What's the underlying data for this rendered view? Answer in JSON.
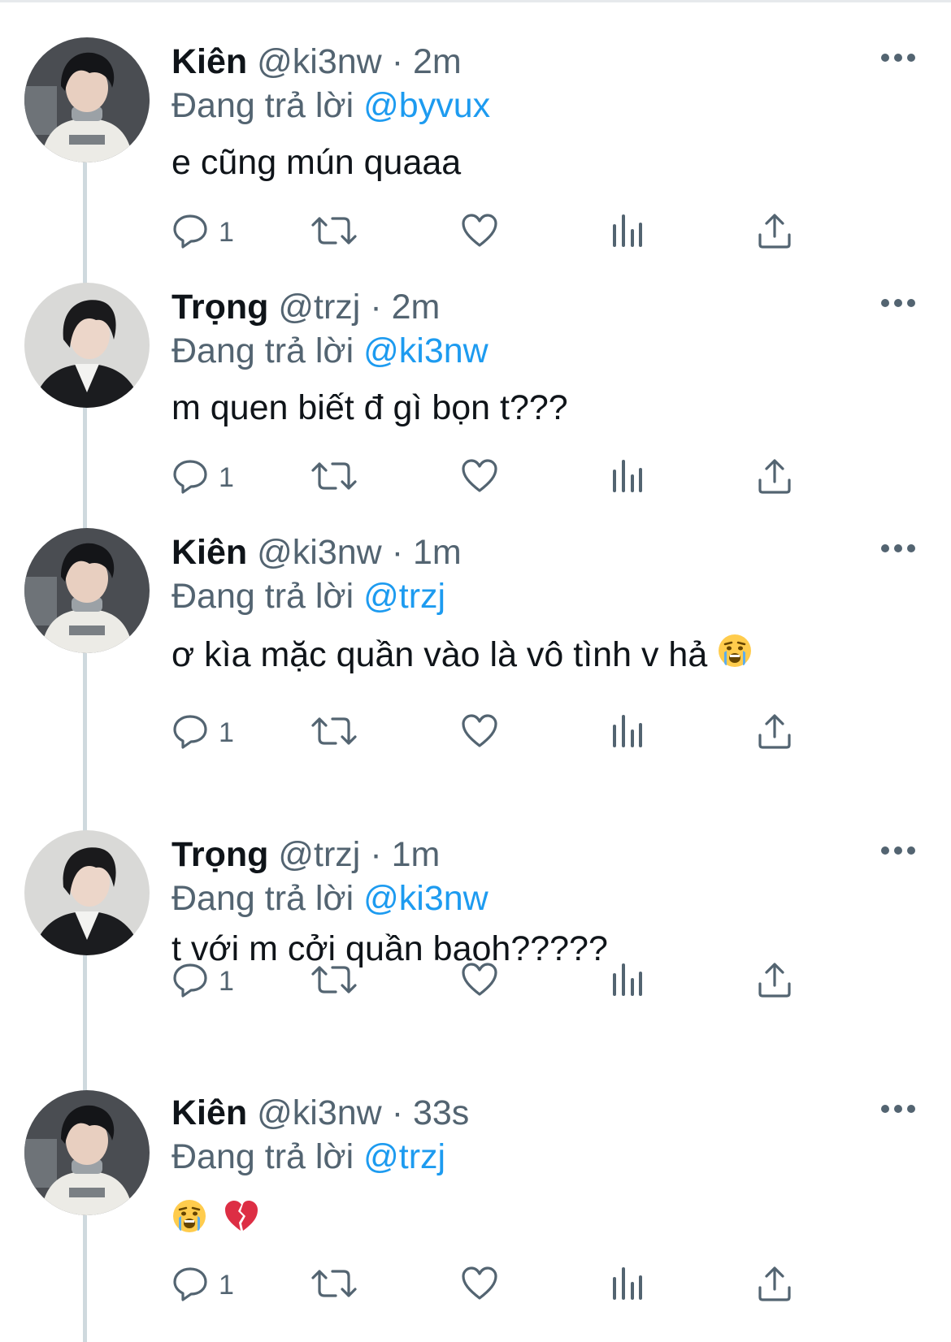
{
  "thread": [
    {
      "avatar": "avatar-kien",
      "name": "Kiên",
      "handle": "@ki3nw",
      "dot": "·",
      "time": "2m",
      "reply_prefix": "Đang trả lời",
      "reply_to": "@byvux",
      "text": "e cũng mún quaaa",
      "reply_count": "1"
    },
    {
      "avatar": "avatar-trong",
      "name": "Trọng",
      "handle": "@trzj",
      "dot": "·",
      "time": "2m",
      "reply_prefix": "Đang trả lời",
      "reply_to": "@ki3nw",
      "text": "m quen biết đ gì bọn t???",
      "reply_count": "1"
    },
    {
      "avatar": "avatar-kien",
      "name": "Kiên",
      "handle": "@ki3nw",
      "dot": "·",
      "time": "1m",
      "reply_prefix": "Đang trả lời",
      "reply_to": "@trzj",
      "text": "ơ kìa mặc quần vào là vô tình v hả",
      "text_emoji": "crying-face-emoji",
      "reply_count": "1"
    },
    {
      "avatar": "avatar-trong",
      "name": "Trọng",
      "handle": "@trzj",
      "dot": "·",
      "time": "1m",
      "reply_prefix": "Đang trả lời",
      "reply_to": "@ki3nw",
      "text": "t với m cởi quần baoh?????",
      "reply_count": "1"
    },
    {
      "avatar": "avatar-kien",
      "name": "Kiên",
      "handle": "@ki3nw",
      "dot": "·",
      "time": "33s",
      "reply_prefix": "Đang trả lời",
      "reply_to": "@trzj",
      "text": "",
      "text_emoji": [
        "crying-face-emoji",
        "broken-heart-emoji"
      ],
      "reply_count": "1"
    }
  ],
  "icons": {
    "more": "more-dots-icon",
    "reply": "reply-icon",
    "retweet": "retweet-icon",
    "like": "like-icon",
    "analytics": "analytics-icon",
    "share": "share-icon"
  },
  "colors": {
    "text": "#0f1419",
    "secondary": "#536471",
    "mention": "#1d9bf0",
    "thread_line": "#cfd9de"
  }
}
